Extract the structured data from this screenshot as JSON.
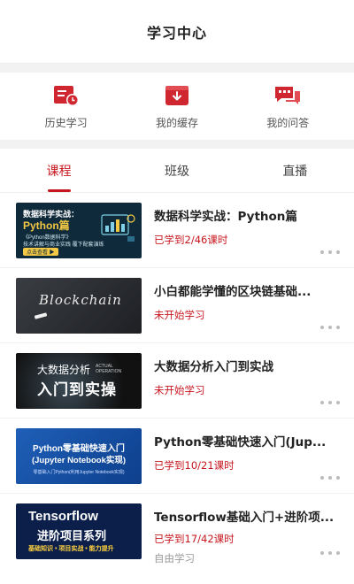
{
  "header": {
    "title": "学习中心"
  },
  "quick": [
    {
      "label": "历史学习",
      "icon": "history-icon"
    },
    {
      "label": "我的缓存",
      "icon": "download-cache-icon"
    },
    {
      "label": "我的问答",
      "icon": "qa-chat-icon"
    }
  ],
  "tabs": [
    {
      "label": "课程",
      "active": true
    },
    {
      "label": "班级",
      "active": false
    },
    {
      "label": "直播",
      "active": false
    }
  ],
  "courses": [
    {
      "title": "数据科学实战：Python篇",
      "status": "已学到2/46课时",
      "thumb": {
        "line1": "数据科学实战：",
        "line2": "Python篇",
        "line3": "《Python数据科学》",
        "line4": "技术讲解与商业实践 覆下配套演练",
        "badge": "点击查看 ▶"
      }
    },
    {
      "title": "小白都能学懂的区块链基础...",
      "status": "未开始学习",
      "thumb": {
        "line1": "Blockchain"
      }
    },
    {
      "title": "大数据分析入门到实战",
      "status": "未开始学习",
      "thumb": {
        "line1": "大数据分析",
        "line2": "入门到实操",
        "tag": "ACTUAL OPERATION"
      }
    },
    {
      "title": "Python零基础快速入门(Jup...",
      "status": "已学到10/21课时",
      "thumb": {
        "line1": "Python零基础快速入门",
        "line2": "(Jupyter Notebook实现)",
        "line3": "零基础入门Python(利用Jupyter Notebook实现)"
      }
    },
    {
      "title": "Tensorflow基础入门+进阶项...",
      "status": "已学到17/42课时",
      "sub": "自由学习",
      "thumb": {
        "line1": "Tensorflow",
        "line2": "进阶项目系列",
        "line3": "基础知识 • 项目实战 • 能力提升"
      }
    }
  ],
  "colors": {
    "accent": "#c7161e",
    "separator": "#f2f2f2"
  }
}
